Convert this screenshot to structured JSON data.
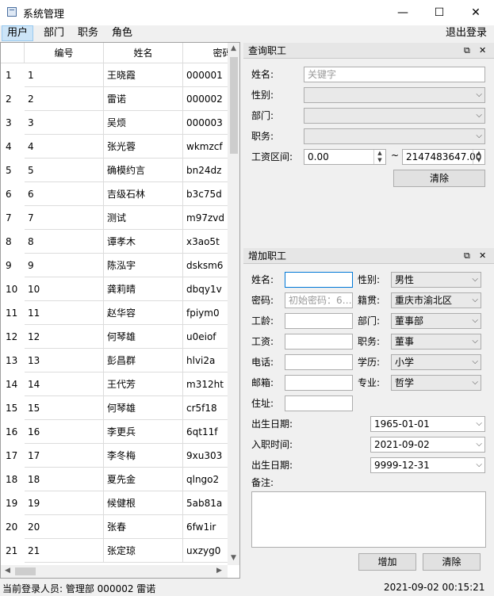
{
  "window": {
    "title": "系统管理",
    "minimize": "—",
    "maximize": "☐",
    "close": "✕"
  },
  "menu": {
    "items": [
      "用户",
      "部门",
      "职务",
      "角色"
    ],
    "logout": "退出登录"
  },
  "table": {
    "columns": [
      "编号",
      "姓名",
      "密码"
    ],
    "rows": [
      {
        "num": "1",
        "id": "1",
        "name": "王晓霞",
        "pwd": "000001"
      },
      {
        "num": "2",
        "id": "2",
        "name": "雷诺",
        "pwd": "000002"
      },
      {
        "num": "3",
        "id": "3",
        "name": "吴烦",
        "pwd": "000003"
      },
      {
        "num": "4",
        "id": "4",
        "name": "张光蓉",
        "pwd": "wkmzcf"
      },
      {
        "num": "5",
        "id": "5",
        "name": "确模约言",
        "pwd": "bn24dz"
      },
      {
        "num": "6",
        "id": "6",
        "name": "吉级石林",
        "pwd": "b3c75d"
      },
      {
        "num": "7",
        "id": "7",
        "name": "测试",
        "pwd": "m97zvd"
      },
      {
        "num": "8",
        "id": "8",
        "name": "谭孝木",
        "pwd": "x3ao5t"
      },
      {
        "num": "9",
        "id": "9",
        "name": "陈泓宇",
        "pwd": "dsksm6"
      },
      {
        "num": "10",
        "id": "10",
        "name": "龚莉晴",
        "pwd": "dbqy1v"
      },
      {
        "num": "11",
        "id": "11",
        "name": "赵华容",
        "pwd": "fpiym0"
      },
      {
        "num": "12",
        "id": "12",
        "name": "何琴雄",
        "pwd": "u0eiof"
      },
      {
        "num": "13",
        "id": "13",
        "name": "彭昌群",
        "pwd": "hlvi2a"
      },
      {
        "num": "14",
        "id": "14",
        "name": "王代芳",
        "pwd": "m312ht"
      },
      {
        "num": "15",
        "id": "15",
        "name": "何琴雄",
        "pwd": "cr5f18"
      },
      {
        "num": "16",
        "id": "16",
        "name": "李更兵",
        "pwd": "6qt11f"
      },
      {
        "num": "17",
        "id": "17",
        "name": "李冬梅",
        "pwd": "9xu303"
      },
      {
        "num": "18",
        "id": "18",
        "name": "夏先金",
        "pwd": "qlngo2"
      },
      {
        "num": "19",
        "id": "19",
        "name": "候健根",
        "pwd": "5ab81a"
      },
      {
        "num": "20",
        "id": "20",
        "name": "张春",
        "pwd": "6fw1ir"
      },
      {
        "num": "21",
        "id": "21",
        "name": "张定琼",
        "pwd": "uxzyg0"
      }
    ]
  },
  "query": {
    "title": "查询职工",
    "name_label": "姓名:",
    "name_placeholder": "关键字",
    "gender_label": "性别:",
    "dept_label": "部门:",
    "position_label": "职务:",
    "salary_label": "工资区间:",
    "salary_min": "0.00",
    "salary_sep": "~",
    "salary_max": "2147483647.00",
    "clear": "清除"
  },
  "add": {
    "title": "增加职工",
    "name_label": "姓名:",
    "gender_label": "性别:",
    "gender_value": "男性",
    "password_label": "密码:",
    "password_placeholder": "初始密码：6…",
    "origin_label": "籍贯:",
    "origin_value": "重庆市渝北区",
    "seniority_label": "工龄:",
    "dept_label": "部门:",
    "dept_value": "董事部",
    "salary_label": "工资:",
    "position_label": "职务:",
    "position_value": "董事",
    "phone_label": "电话:",
    "education_label": "学历:",
    "education_value": "小学",
    "email_label": "邮箱:",
    "major_label": "专业:",
    "major_value": "哲学",
    "address_label": "住址:",
    "birth_label": "出生日期:",
    "birth_value": "1965-01-01",
    "join_label": "入职时间:",
    "join_value": "2021-09-02",
    "birth2_label": "出生日期:",
    "birth2_value": "9999-12-31",
    "remark_label": "备注:",
    "add_button": "增加",
    "clear_button": "清除"
  },
  "status": {
    "user": "当前登录人员: 管理部 000002 雷诺",
    "datetime": "2021-09-02 00:15:21"
  }
}
